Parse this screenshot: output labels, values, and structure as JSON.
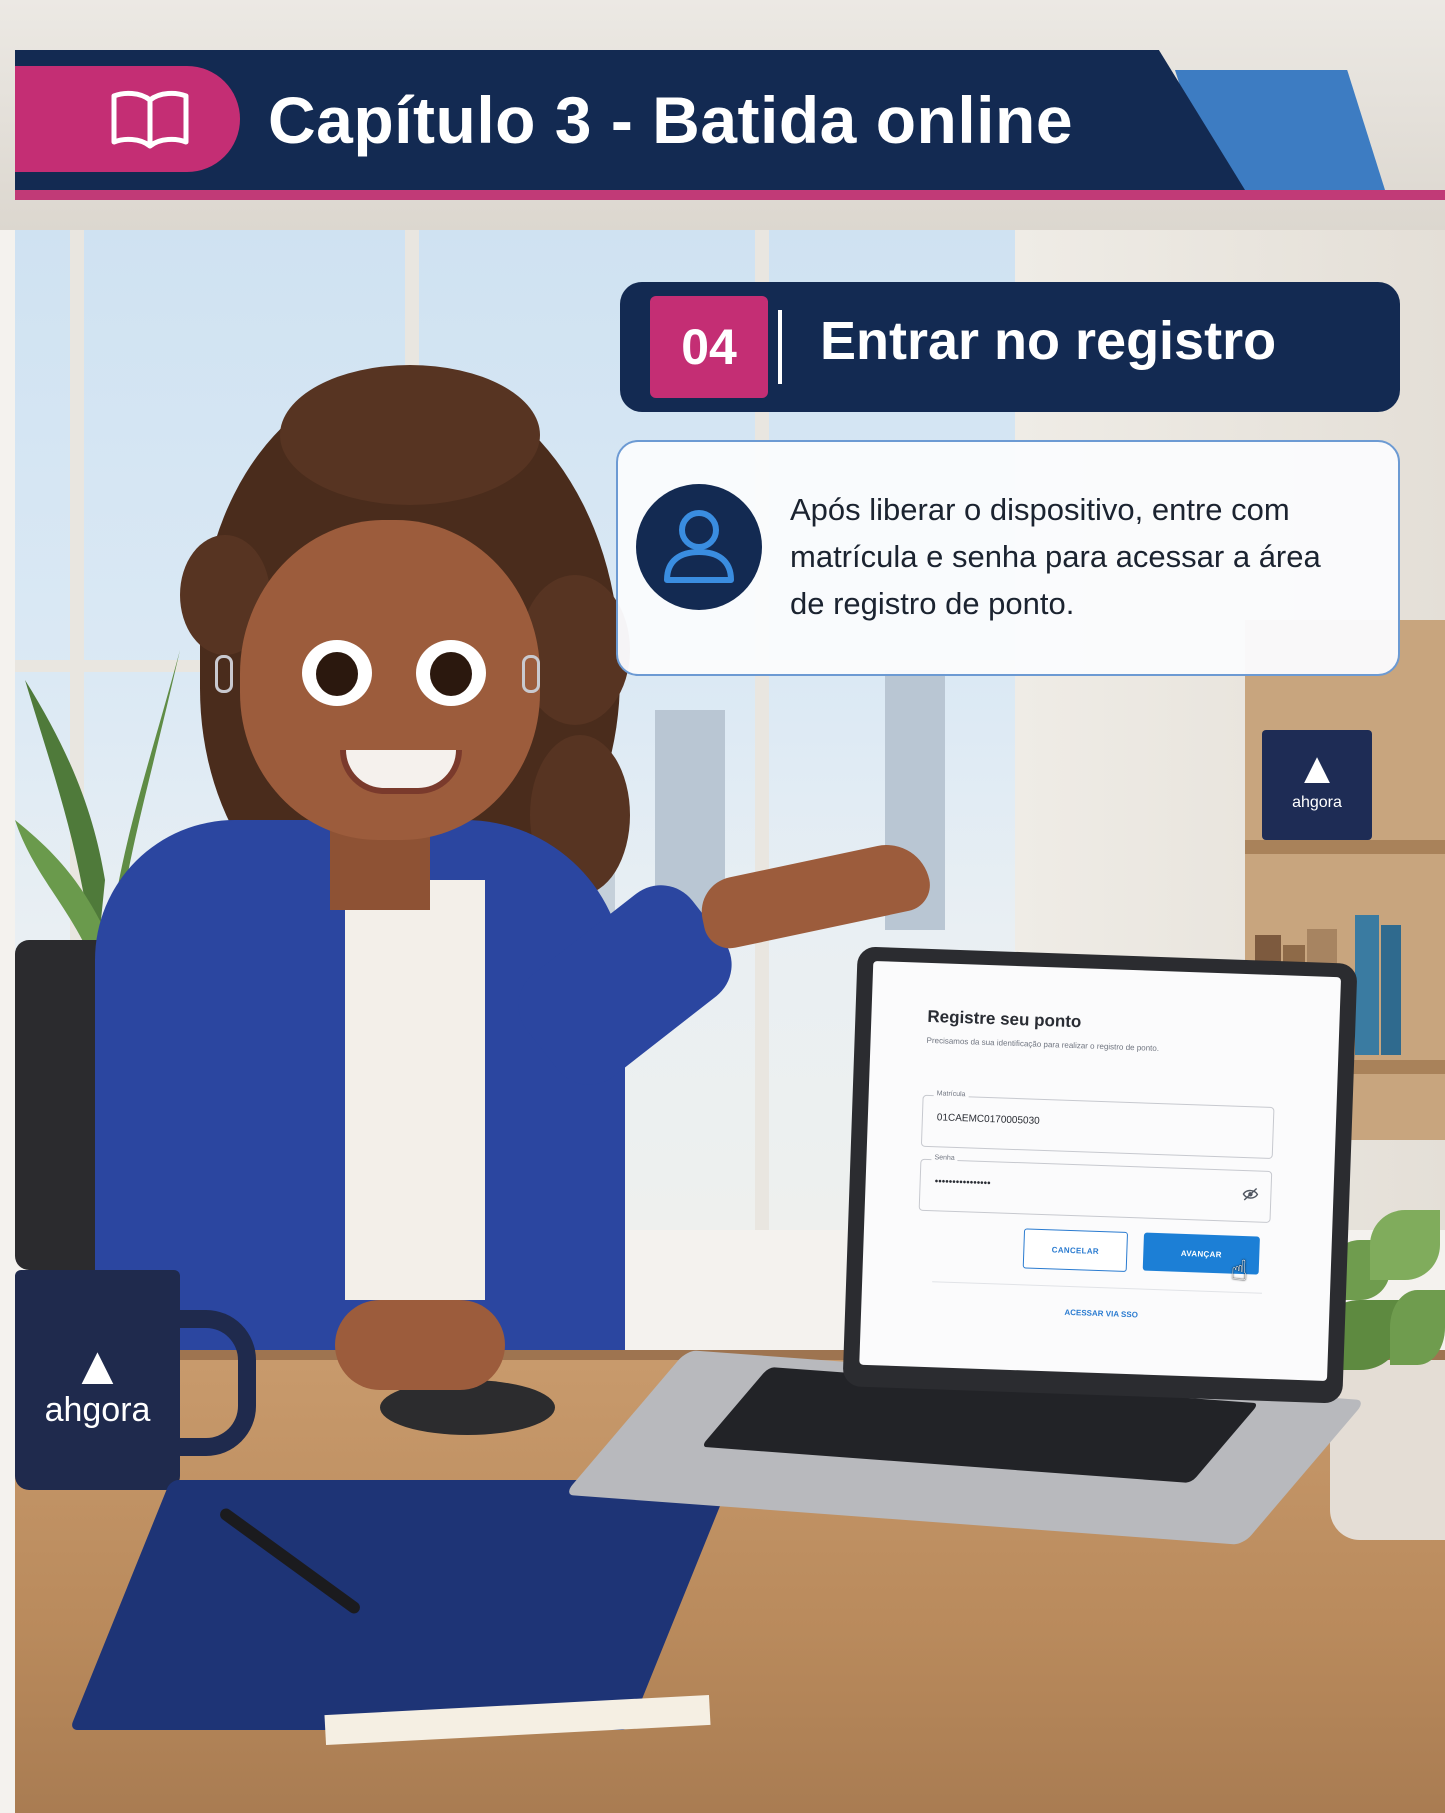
{
  "chapter": {
    "title": "Capítulo 3 - Batida online"
  },
  "step": {
    "number": "04",
    "title": "Entrar no registro",
    "description": "Após liberar o dispositivo, entre com matrícula e senha para acessar a área de registro de ponto."
  },
  "laptop_form": {
    "title": "Registre seu ponto",
    "subtitle": "Precisamos da sua identificação para realizar o registro de ponto.",
    "matricula_label": "Matrícula",
    "matricula_value": "01CAEMC0170005030",
    "senha_label": "Senha",
    "senha_value": "••••••••••••••••",
    "cancel_label": "CANCELAR",
    "next_label": "AVANÇAR",
    "sso_label": "ACESSAR VIA SSO"
  },
  "branding": {
    "mug_logo": "ahgora",
    "board_logo": "ahgora"
  },
  "icons": {
    "chapter": "open-book-icon",
    "info": "user-icon",
    "password": "eye-off-icon",
    "pointer": "hand-cursor-icon"
  },
  "colors": {
    "navy": "#132a52",
    "magenta": "#c42e74",
    "accent_blue": "#3d7cc2",
    "button_blue": "#1c7fd6"
  }
}
